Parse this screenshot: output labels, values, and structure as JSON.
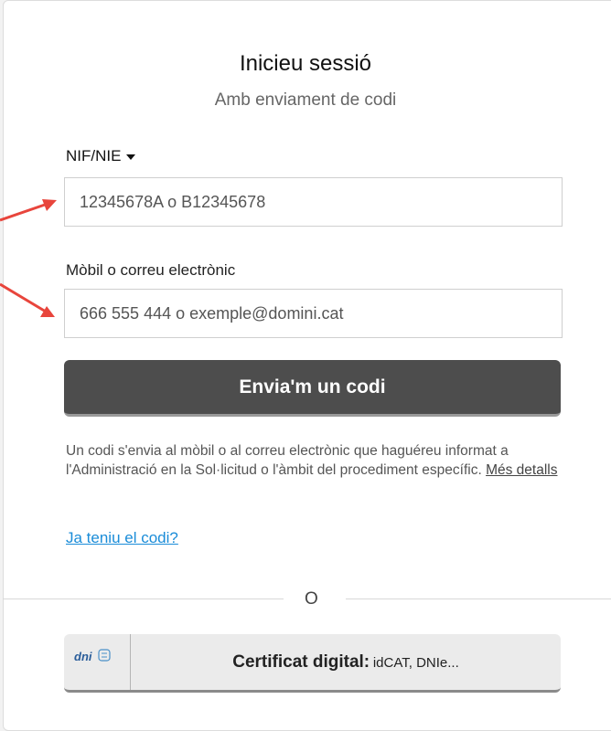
{
  "login": {
    "title": "Inicieu sessió",
    "subtitle": "Amb enviament de codi",
    "id_type": {
      "selected": "NIF/NIE"
    },
    "nif_input": {
      "placeholder": "12345678A o B12345678"
    },
    "contact_label": "Mòbil o correu electrònic",
    "contact_input": {
      "placeholder": "666 555 444 o exemple@domini.cat"
    },
    "send_button": "Envia'm un codi",
    "info_text": "Un codi s'envia al mòbil o al correu electrònic que haguéreu informat a l'Administració en la Sol·licitud o l'àmbit del procediment específic.",
    "more_details_link": "Més detalls",
    "have_code_link": "Ja teniu el codi?",
    "divider_text": "O",
    "cert_button": {
      "strong": "Certificat digital:",
      "rest": "idCAT, DNIe...",
      "logo_text": "dni"
    }
  },
  "colors": {
    "primary_button": "#4d4d4d",
    "link": "#1a8cd8",
    "annotation_arrow": "#e8453c"
  },
  "icons": [
    "caret-down-icon",
    "dni-logo-icon",
    "annotation-arrow-icon"
  ]
}
